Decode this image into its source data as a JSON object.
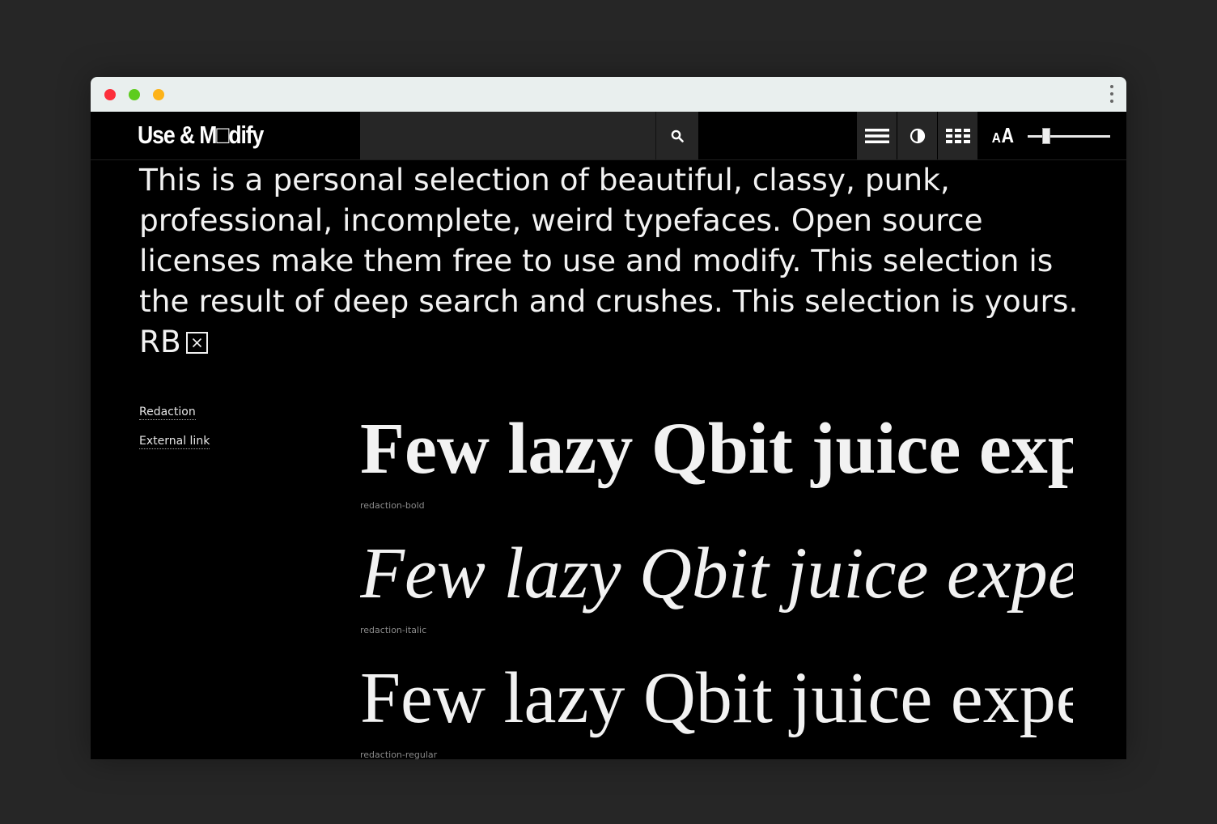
{
  "app": {
    "logo": "Use & M□dify"
  },
  "toolbar": {
    "search_value": "",
    "icons": {
      "search": "search-icon",
      "list_view": "list-view-icon",
      "contrast": "contrast-icon",
      "grid_view": "grid-view-icon",
      "font_size": "font-size-icon"
    },
    "font_size_slider_fraction": 0.2
  },
  "intro": {
    "text": "This is a personal selection of beautiful, classy, punk, professional, incomplete, weird typefaces. Open source licenses make them free to use and modify. This selection is the result of deep search and crushes. This selection is yours. RB"
  },
  "sidebar": {
    "links": [
      {
        "label": "Redaction"
      },
      {
        "label": "External link"
      }
    ]
  },
  "specimens": [
    {
      "sample": "Few lazy Qbit juice experts",
      "style": "redaction-bold"
    },
    {
      "sample": "Few lazy Qbit juice experts",
      "style": "redaction-italic"
    },
    {
      "sample": "Few lazy Qbit juice experts",
      "style": "redaction-regular"
    }
  ],
  "colors": {
    "background": "#262626",
    "page": "#000000",
    "text": "#f2f2f2",
    "label": "#8a8a8a",
    "titlebar": "#e9efee"
  }
}
